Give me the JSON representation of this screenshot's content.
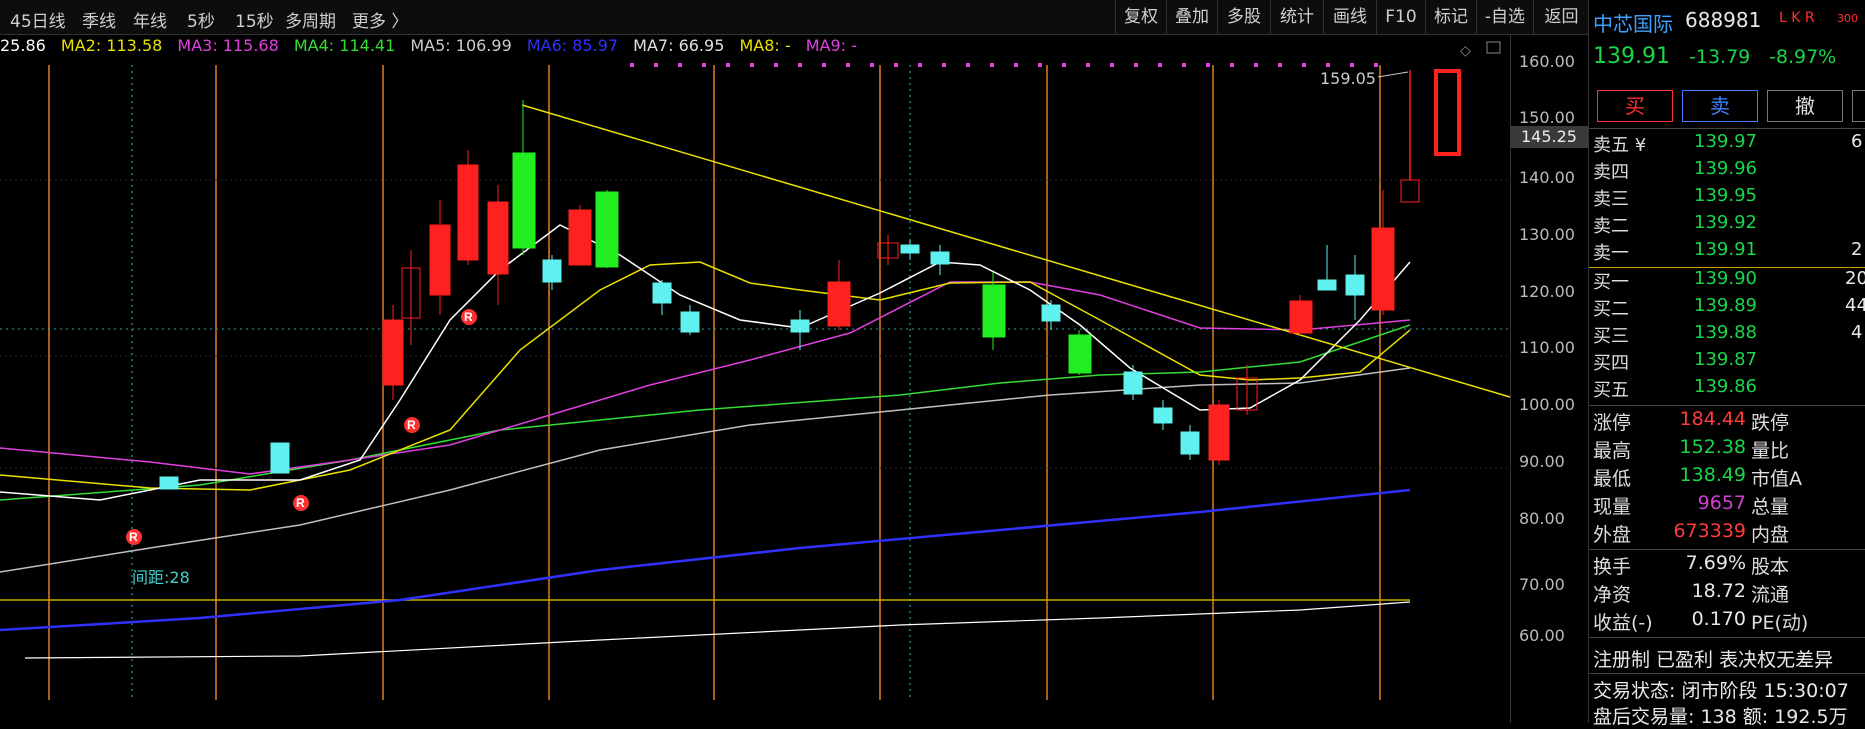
{
  "toolbar": {
    "timeframes": [
      "45日线",
      "季线",
      "年线",
      "5秒",
      "15秒",
      "多周期",
      "更多 〉"
    ],
    "buttons": [
      "复权",
      "叠加",
      "多股",
      "统计",
      "画线",
      "F10",
      "标记",
      "-自选",
      "返回"
    ]
  },
  "ma_legend": [
    {
      "label": "25.86",
      "color": "#ffffff"
    },
    {
      "label": "MA2: 113.58",
      "color": "#e8e000"
    },
    {
      "label": "MA3: 115.68",
      "color": "#e040e0"
    },
    {
      "label": "MA4: 114.41",
      "color": "#33dd33"
    },
    {
      "label": "MA5: 106.99",
      "color": "#cccccc"
    },
    {
      "label": "MA6: 85.97",
      "color": "#3030ff"
    },
    {
      "label": "MA7: 66.95",
      "color": "#e0e0e0"
    },
    {
      "label": "MA8: -",
      "color": "#e8e000"
    },
    {
      "label": "MA9: -",
      "color": "#e040e0"
    }
  ],
  "chart": {
    "high_label": "159.05",
    "last_price_tag": "145.25",
    "interval_label": "间距:28",
    "y_ticks": [
      "160.00",
      "150.00",
      "140.00",
      "130.00",
      "120.00",
      "110.00",
      "100.00",
      "90.00",
      "80.00",
      "70.00",
      "60.00"
    ],
    "marker_text": "R",
    "colors": {
      "up": "#ff2020",
      "down": "#5ff0f0",
      "bigdown": "#22ee22"
    }
  },
  "quote": {
    "name": "中芯国际",
    "code": "688981",
    "tags": "L K R",
    "index_tag": "300",
    "price": "139.91",
    "change": "-13.79",
    "change_pct": "-8.97%"
  },
  "trade_buttons": [
    "买",
    "卖",
    "撤"
  ],
  "orderbook": {
    "asks": [
      {
        "label": "卖五 ¥",
        "price": "139.97",
        "vol": "6"
      },
      {
        "label": "卖四",
        "price": "139.96",
        "vol": ""
      },
      {
        "label": "卖三",
        "price": "139.95",
        "vol": ""
      },
      {
        "label": "卖二",
        "price": "139.92",
        "vol": ""
      },
      {
        "label": "卖一",
        "price": "139.91",
        "vol": "2"
      }
    ],
    "bids": [
      {
        "label": "买一",
        "price": "139.90",
        "vol": "20"
      },
      {
        "label": "买二",
        "price": "139.89",
        "vol": "44"
      },
      {
        "label": "买三",
        "price": "139.88",
        "vol": "4"
      },
      {
        "label": "买四",
        "price": "139.87",
        "vol": ""
      },
      {
        "label": "买五",
        "price": "139.86",
        "vol": ""
      }
    ]
  },
  "stats": [
    {
      "l1": "涨停",
      "v1": "184.44",
      "c1": "#ff3b3b",
      "l2": "跌停"
    },
    {
      "l1": "最高",
      "v1": "152.38",
      "c1": "#19d64a",
      "l2": "量比"
    },
    {
      "l1": "最低",
      "v1": "138.49",
      "c1": "#19d64a",
      "l2": "市值A"
    },
    {
      "l1": "现量",
      "v1": "9657",
      "c1": "#d040d0",
      "l2": "总量"
    },
    {
      "l1": "外盘",
      "v1": "673339",
      "c1": "#ff3b3b",
      "l2": "内盘"
    }
  ],
  "stats2": [
    {
      "l1": "换手",
      "v1": "7.69%",
      "c1": "#e8e8e8",
      "l2": "股本"
    },
    {
      "l1": "净资",
      "v1": "18.72",
      "c1": "#e8e8e8",
      "l2": "流通"
    },
    {
      "l1": "收益(-)",
      "v1": "0.170",
      "c1": "#e8e8e8",
      "l2": "PE(动)"
    }
  ],
  "notice": "注册制 已盈利 表决权无差异",
  "trade_status": "交易状态: 闭市阶段 15:30:07",
  "after_hours": "盘后交易量: 138  额: 192.5万"
}
